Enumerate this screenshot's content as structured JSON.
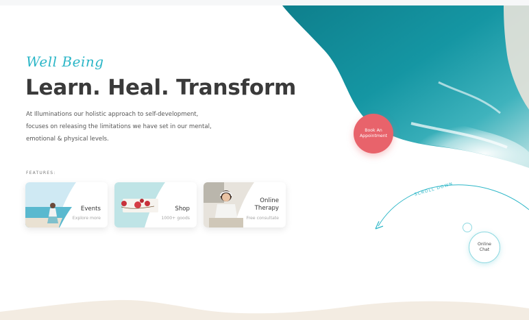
{
  "hero": {
    "script_title": "Well Being",
    "headline": "Learn. Heal. Transform",
    "intro_lines": [
      "At Illuminations our holistic approach to self-development,",
      "focuses on releasing the limitations we have set in our mental,",
      "emotional & physical levels."
    ]
  },
  "features": {
    "label": "FEATURES:",
    "cards": [
      {
        "title_lines": [
          "Events"
        ],
        "subtitle": "Explore more",
        "icon": "beach-photo"
      },
      {
        "title_lines": [
          "Shop"
        ],
        "subtitle": "1000+ goods",
        "icon": "flowers-photo"
      },
      {
        "title_lines": [
          "Online",
          "Therapy"
        ],
        "subtitle": "Free consultate",
        "icon": "headphones-woman-photo"
      }
    ]
  },
  "actions": {
    "book_lines": [
      "Book An",
      "Appointment"
    ],
    "chat_lines": [
      "Online",
      "Chat"
    ],
    "scroll_down": "SCROLL DOWN"
  },
  "colors": {
    "accent": "#2bb6c7",
    "book_button": "#e8636b",
    "heading": "#3a3a3a",
    "sand": "#f3ece2"
  }
}
